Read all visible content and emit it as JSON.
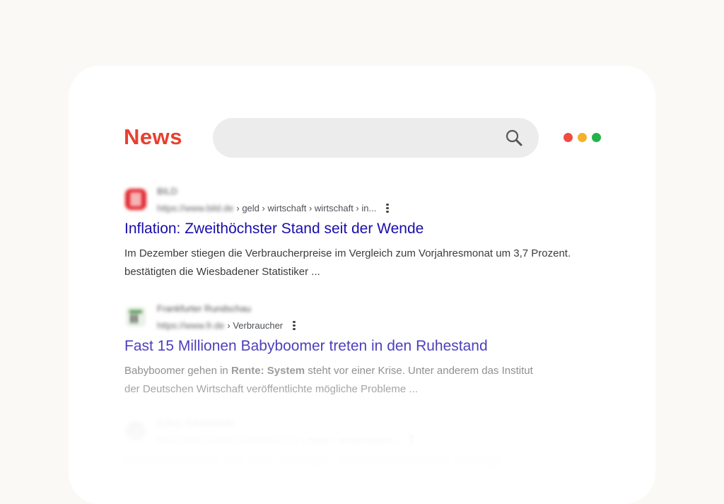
{
  "header": {
    "logo_text": "News",
    "logo_color": "#e8402f",
    "search": {
      "placeholder": "",
      "icon": "search-icon"
    },
    "window_dots": [
      "#ef4b43",
      "#f4b22a",
      "#24b24b"
    ]
  },
  "results": [
    {
      "site_name": "BILD",
      "url_host": "https://www.bild.de",
      "url_path": "› geld › wirtschaft › wirtschaft › in...",
      "title": "Inflation: Zweithöchster Stand seit der Wende",
      "snippet_line1": "Im Dezember stiegen die Verbraucherpreise im Vergleich zum Vorjahresmonat um 3,7 Prozent.",
      "snippet_line2": "bestätigten die Wiesbadener Statistiker ..."
    },
    {
      "site_name": "Frankfurter Rundschau",
      "url_host": "https://www.fr.de",
      "url_path": "› Verbraucher",
      "title": "Fast 15 Millionen Babyboomer treten in den Ruhestand",
      "snippet_pre": "Babyboomer gehen in ",
      "snippet_bold": "Rente: System",
      "snippet_post": " steht vor einer Krise. Unter anderem das Institut",
      "snippet_line2": "der Deutschen Wirtschaft veröffentlichte mögliche Probleme ..."
    },
    {
      "site_name": "Kölner Edelmetalle",
      "url_host": "https://www.koelner-edelmetalle.de",
      "url_path": "› news › rentensystem...",
      "title": "Rentensystem vor dem Kollaps: Wirtschaftsweise schlägt"
    }
  ]
}
